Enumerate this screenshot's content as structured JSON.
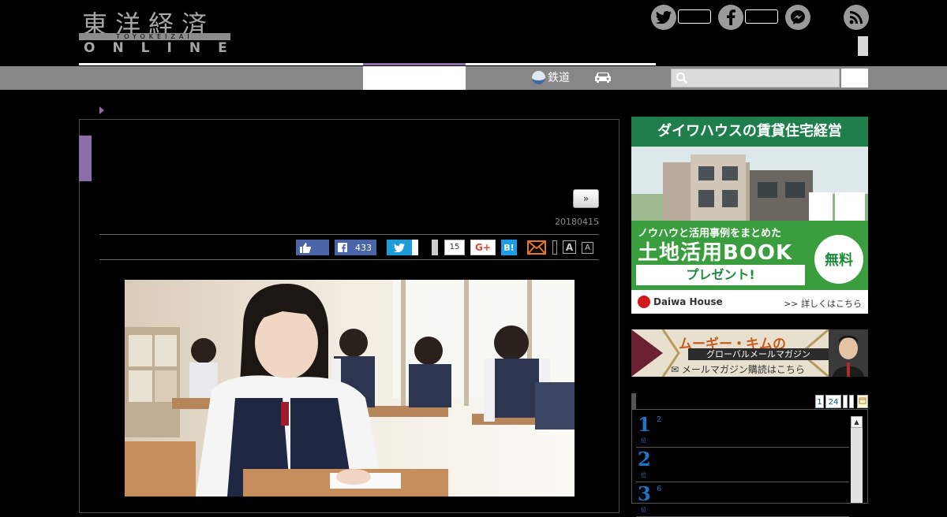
{
  "header": {
    "logo_kanji": "東洋経済",
    "logo_romaji": "TOYOKEIZAI",
    "logo_online": "ONLINE",
    "social": [
      "twitter-icon",
      "facebook-icon",
      "messenger-icon",
      "rss-icon"
    ]
  },
  "nav": {
    "rail_label": "鉄道",
    "icons": [
      "train-icon",
      "car-icon",
      "search-icon"
    ]
  },
  "article": {
    "next_label": "»",
    "date": "20180415",
    "share": {
      "facebook_count": "433",
      "pocket_count": "15",
      "gplus_label": "G+",
      "hatena_label": "B!",
      "font_large": "A",
      "font_small": "A"
    }
  },
  "sidebar": {
    "ad1": {
      "headline": "ダイワハウスの賃貸住宅経営",
      "line1": "ノウハウと活用事例をまとめた",
      "line2": "土地活用BOOK",
      "present": "プレゼント!",
      "free": "無料",
      "logo": "Daiwa House",
      "link": ">> 詳しくはこちら"
    },
    "ad2": {
      "title": "ムーギー・キムの",
      "subtitle": "グローバルメールマガジン",
      "mail": "✉ メールマガジン購読はこちら"
    },
    "ranking": {
      "tabs": [
        "1",
        "24",
        "",
        "",
        "📅"
      ],
      "items": [
        {
          "num": "1",
          "sub": "位",
          "text": "2"
        },
        {
          "num": "2",
          "sub": "位",
          "text": ""
        },
        {
          "num": "3",
          "sub": "位",
          "text": "6"
        }
      ]
    }
  },
  "colors": {
    "accent": "#8b6ea8",
    "nav_gray": "#878787",
    "facebook": "#4b66a8",
    "twitter": "#1d9bd8",
    "hatena": "#1c9de8",
    "rank_blue": "#1976c8"
  }
}
